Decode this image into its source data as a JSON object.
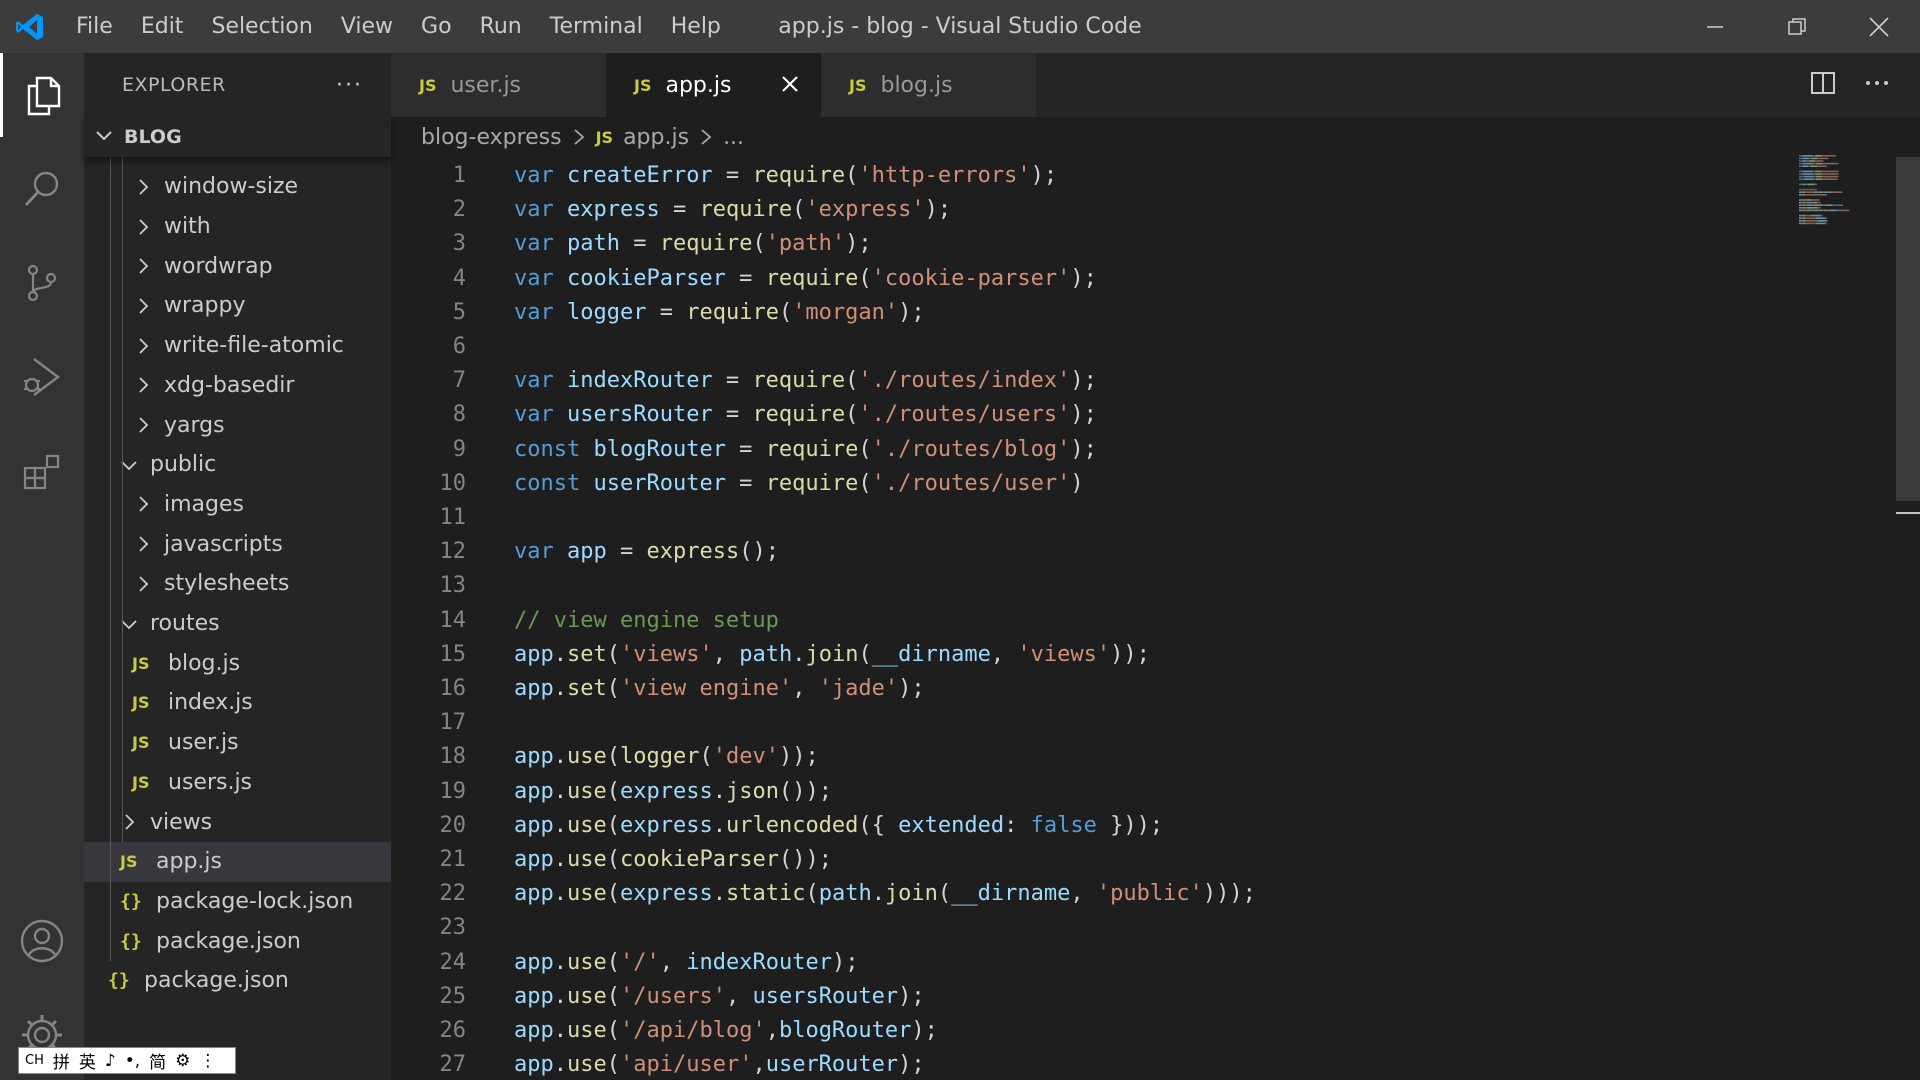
{
  "window": {
    "title": "app.js - blog - Visual Studio Code",
    "menu": [
      "File",
      "Edit",
      "Selection",
      "View",
      "Go",
      "Run",
      "Terminal",
      "Help"
    ]
  },
  "activity_bar": {
    "items": [
      "files-icon",
      "search-icon",
      "source-control-icon",
      "run-debug-icon",
      "extensions-icon"
    ],
    "bottom": [
      "account-icon",
      "gear-icon"
    ]
  },
  "sidebar": {
    "title": "EXPLORER",
    "more": "···",
    "section": "BLOG",
    "tree": [
      {
        "label": "window-size",
        "kind": "folder",
        "depth": 2,
        "expanded": false
      },
      {
        "label": "with",
        "kind": "folder",
        "depth": 2,
        "expanded": false
      },
      {
        "label": "wordwrap",
        "kind": "folder",
        "depth": 2,
        "expanded": false
      },
      {
        "label": "wrappy",
        "kind": "folder",
        "depth": 2,
        "expanded": false
      },
      {
        "label": "write-file-atomic",
        "kind": "folder",
        "depth": 2,
        "expanded": false
      },
      {
        "label": "xdg-basedir",
        "kind": "folder",
        "depth": 2,
        "expanded": false
      },
      {
        "label": "yargs",
        "kind": "folder",
        "depth": 2,
        "expanded": false
      },
      {
        "label": "public",
        "kind": "folder",
        "depth": 1,
        "expanded": true
      },
      {
        "label": "images",
        "kind": "folder",
        "depth": 2,
        "expanded": false
      },
      {
        "label": "javascripts",
        "kind": "folder",
        "depth": 2,
        "expanded": false
      },
      {
        "label": "stylesheets",
        "kind": "folder",
        "depth": 2,
        "expanded": false
      },
      {
        "label": "routes",
        "kind": "folder",
        "depth": 1,
        "expanded": true
      },
      {
        "label": "blog.js",
        "kind": "js",
        "depth": 2
      },
      {
        "label": "index.js",
        "kind": "js",
        "depth": 2
      },
      {
        "label": "user.js",
        "kind": "js",
        "depth": 2
      },
      {
        "label": "users.js",
        "kind": "js",
        "depth": 2
      },
      {
        "label": "views",
        "kind": "folder",
        "depth": 1,
        "expanded": false
      },
      {
        "label": "app.js",
        "kind": "js",
        "depth": 1,
        "selected": true
      },
      {
        "label": "package-lock.json",
        "kind": "json",
        "depth": 1
      },
      {
        "label": "package.json",
        "kind": "json",
        "depth": 1
      },
      {
        "label": "package.json",
        "kind": "json",
        "depth": 0
      }
    ],
    "js_badge": "JS",
    "json_badge": "{}"
  },
  "ime": {
    "items": [
      "CH",
      "拼",
      "英",
      "♪",
      "•,",
      "简",
      "⚙",
      "⋮"
    ]
  },
  "tabs": [
    {
      "label": "user.js",
      "active": false
    },
    {
      "label": "app.js",
      "active": true
    },
    {
      "label": "blog.js",
      "active": false
    }
  ],
  "breadcrumb": {
    "folder": "blog-express",
    "file": "app.js",
    "tail": "..."
  },
  "code": [
    [
      [
        "kw",
        "var "
      ],
      [
        "var",
        "createError"
      ],
      [
        "pl",
        " = "
      ],
      [
        "fn",
        "require"
      ],
      [
        "pl",
        "("
      ],
      [
        "str",
        "'http-errors'"
      ],
      [
        "pl",
        ");"
      ]
    ],
    [
      [
        "kw",
        "var "
      ],
      [
        "var",
        "express"
      ],
      [
        "pl",
        " = "
      ],
      [
        "fn",
        "require"
      ],
      [
        "pl",
        "("
      ],
      [
        "str",
        "'express'"
      ],
      [
        "pl",
        ");"
      ]
    ],
    [
      [
        "kw",
        "var "
      ],
      [
        "var",
        "path"
      ],
      [
        "pl",
        " = "
      ],
      [
        "fn",
        "require"
      ],
      [
        "pl",
        "("
      ],
      [
        "str",
        "'path'"
      ],
      [
        "pl",
        ");"
      ]
    ],
    [
      [
        "kw",
        "var "
      ],
      [
        "var",
        "cookieParser"
      ],
      [
        "pl",
        " = "
      ],
      [
        "fn",
        "require"
      ],
      [
        "pl",
        "("
      ],
      [
        "str",
        "'cookie-parser'"
      ],
      [
        "pl",
        ");"
      ]
    ],
    [
      [
        "kw",
        "var "
      ],
      [
        "var",
        "logger"
      ],
      [
        "pl",
        " = "
      ],
      [
        "fn",
        "require"
      ],
      [
        "pl",
        "("
      ],
      [
        "str",
        "'morgan'"
      ],
      [
        "pl",
        ");"
      ]
    ],
    [],
    [
      [
        "kw",
        "var "
      ],
      [
        "var",
        "indexRouter"
      ],
      [
        "pl",
        " = "
      ],
      [
        "fn",
        "require"
      ],
      [
        "pl",
        "("
      ],
      [
        "str",
        "'./routes/index'"
      ],
      [
        "pl",
        ");"
      ]
    ],
    [
      [
        "kw",
        "var "
      ],
      [
        "var",
        "usersRouter"
      ],
      [
        "pl",
        " = "
      ],
      [
        "fn",
        "require"
      ],
      [
        "pl",
        "("
      ],
      [
        "str",
        "'./routes/users'"
      ],
      [
        "pl",
        ");"
      ]
    ],
    [
      [
        "kw",
        "const "
      ],
      [
        "var",
        "blogRouter"
      ],
      [
        "pl",
        " = "
      ],
      [
        "fn",
        "require"
      ],
      [
        "pl",
        "("
      ],
      [
        "str",
        "'./routes/blog'"
      ],
      [
        "pl",
        ");"
      ]
    ],
    [
      [
        "kw",
        "const "
      ],
      [
        "var",
        "userRouter"
      ],
      [
        "pl",
        " = "
      ],
      [
        "fn",
        "require"
      ],
      [
        "pl",
        "("
      ],
      [
        "str",
        "'./routes/user'"
      ],
      [
        "pl",
        ")"
      ]
    ],
    [],
    [
      [
        "kw",
        "var "
      ],
      [
        "var",
        "app"
      ],
      [
        "pl",
        " = "
      ],
      [
        "fn",
        "express"
      ],
      [
        "pl",
        "();"
      ]
    ],
    [],
    [
      [
        "cm",
        "// view engine setup"
      ]
    ],
    [
      [
        "var",
        "app"
      ],
      [
        "pl",
        "."
      ],
      [
        "fn",
        "set"
      ],
      [
        "pl",
        "("
      ],
      [
        "str",
        "'views'"
      ],
      [
        "pl",
        ", "
      ],
      [
        "var",
        "path"
      ],
      [
        "pl",
        "."
      ],
      [
        "fn",
        "join"
      ],
      [
        "pl",
        "("
      ],
      [
        "var",
        "__dirname"
      ],
      [
        "pl",
        ", "
      ],
      [
        "str",
        "'views'"
      ],
      [
        "pl",
        "));"
      ]
    ],
    [
      [
        "var",
        "app"
      ],
      [
        "pl",
        "."
      ],
      [
        "fn",
        "set"
      ],
      [
        "pl",
        "("
      ],
      [
        "str",
        "'view engine'"
      ],
      [
        "pl",
        ", "
      ],
      [
        "str",
        "'jade'"
      ],
      [
        "pl",
        ");"
      ]
    ],
    [],
    [
      [
        "var",
        "app"
      ],
      [
        "pl",
        "."
      ],
      [
        "fn",
        "use"
      ],
      [
        "pl",
        "("
      ],
      [
        "fn",
        "logger"
      ],
      [
        "pl",
        "("
      ],
      [
        "str",
        "'dev'"
      ],
      [
        "pl",
        "));"
      ]
    ],
    [
      [
        "var",
        "app"
      ],
      [
        "pl",
        "."
      ],
      [
        "fn",
        "use"
      ],
      [
        "pl",
        "("
      ],
      [
        "var",
        "express"
      ],
      [
        "pl",
        "."
      ],
      [
        "fn",
        "json"
      ],
      [
        "pl",
        "());"
      ]
    ],
    [
      [
        "var",
        "app"
      ],
      [
        "pl",
        "."
      ],
      [
        "fn",
        "use"
      ],
      [
        "pl",
        "("
      ],
      [
        "var",
        "express"
      ],
      [
        "pl",
        "."
      ],
      [
        "fn",
        "urlencoded"
      ],
      [
        "pl",
        "({ "
      ],
      [
        "var",
        "extended"
      ],
      [
        "pl",
        ": "
      ],
      [
        "kw",
        "false"
      ],
      [
        "pl",
        " }));"
      ]
    ],
    [
      [
        "var",
        "app"
      ],
      [
        "pl",
        "."
      ],
      [
        "fn",
        "use"
      ],
      [
        "pl",
        "("
      ],
      [
        "fn",
        "cookieParser"
      ],
      [
        "pl",
        "());"
      ]
    ],
    [
      [
        "var",
        "app"
      ],
      [
        "pl",
        "."
      ],
      [
        "fn",
        "use"
      ],
      [
        "pl",
        "("
      ],
      [
        "var",
        "express"
      ],
      [
        "pl",
        "."
      ],
      [
        "fn",
        "static"
      ],
      [
        "pl",
        "("
      ],
      [
        "var",
        "path"
      ],
      [
        "pl",
        "."
      ],
      [
        "fn",
        "join"
      ],
      [
        "pl",
        "("
      ],
      [
        "var",
        "__dirname"
      ],
      [
        "pl",
        ", "
      ],
      [
        "str",
        "'public'"
      ],
      [
        "pl",
        ")));"
      ]
    ],
    [],
    [
      [
        "var",
        "app"
      ],
      [
        "pl",
        "."
      ],
      [
        "fn",
        "use"
      ],
      [
        "pl",
        "("
      ],
      [
        "str",
        "'/'"
      ],
      [
        "pl",
        ", "
      ],
      [
        "var",
        "indexRouter"
      ],
      [
        "pl",
        ");"
      ]
    ],
    [
      [
        "var",
        "app"
      ],
      [
        "pl",
        "."
      ],
      [
        "fn",
        "use"
      ],
      [
        "pl",
        "("
      ],
      [
        "str",
        "'/users'"
      ],
      [
        "pl",
        ", "
      ],
      [
        "var",
        "usersRouter"
      ],
      [
        "pl",
        ");"
      ]
    ],
    [
      [
        "var",
        "app"
      ],
      [
        "pl",
        "."
      ],
      [
        "fn",
        "use"
      ],
      [
        "pl",
        "("
      ],
      [
        "str",
        "'/api/blog'"
      ],
      [
        "pl",
        ","
      ],
      [
        "var",
        "blogRouter"
      ],
      [
        "pl",
        ");"
      ]
    ],
    [
      [
        "var",
        "app"
      ],
      [
        "pl",
        "."
      ],
      [
        "fn",
        "use"
      ],
      [
        "pl",
        "("
      ],
      [
        "str",
        "'api/user'"
      ],
      [
        "pl",
        ","
      ],
      [
        "var",
        "userRouter"
      ],
      [
        "pl",
        ");"
      ]
    ]
  ],
  "colors": {
    "keyword": "#569cd6",
    "variable": "#9cdcfe",
    "function": "#dcdcaa",
    "string": "#ce9178",
    "comment": "#6a9955",
    "js_badge": "#cbcb41",
    "vscode_blue": "#0098ff"
  }
}
